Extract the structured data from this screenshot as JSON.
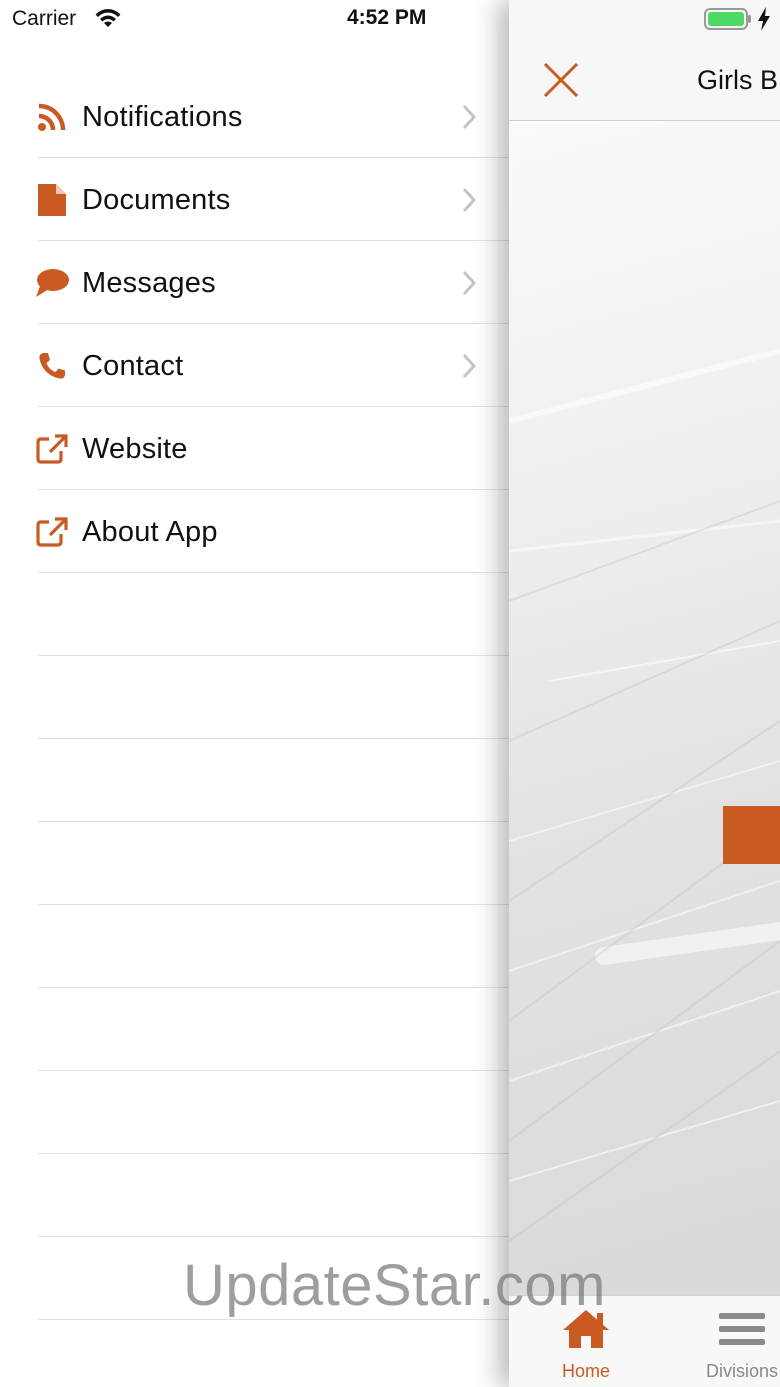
{
  "status_bar": {
    "carrier": "Carrier",
    "time": "4:52 PM",
    "icons": [
      "wifi-icon",
      "battery-icon",
      "charging-bolt-icon"
    ]
  },
  "menu": {
    "items": [
      {
        "label": "Notifications",
        "icon": "rss-icon",
        "has_chevron": true
      },
      {
        "label": "Documents",
        "icon": "document-icon",
        "has_chevron": true
      },
      {
        "label": "Messages",
        "icon": "speech-bubble-icon",
        "has_chevron": true
      },
      {
        "label": "Contact",
        "icon": "phone-icon",
        "has_chevron": true
      },
      {
        "label": "Website",
        "icon": "external-link-icon",
        "has_chevron": false
      },
      {
        "label": "About App",
        "icon": "external-link-icon",
        "has_chevron": false
      }
    ]
  },
  "main": {
    "title": "Girls B",
    "close_icon": "close-icon"
  },
  "tab_bar": {
    "tabs": [
      {
        "label": "Home",
        "icon": "home-icon",
        "active": true
      },
      {
        "label": "Divisions",
        "icon": "menu-lines-icon",
        "active": false
      }
    ]
  },
  "watermark": "UpdateStar.com",
  "colors": {
    "accent": "#c95a22",
    "inactive_tab": "#888888",
    "separator": "#e1e1e1",
    "battery": "#4cd964"
  }
}
